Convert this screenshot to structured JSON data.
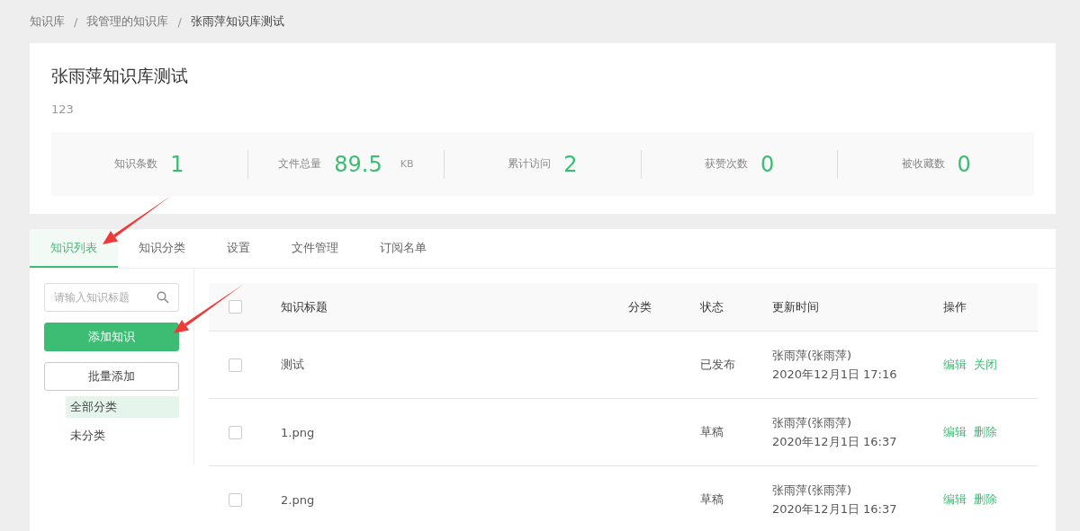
{
  "breadcrumb_separator": "/",
  "breadcrumb": [
    {
      "label": "知识库",
      "current": false
    },
    {
      "label": "我管理的知识库",
      "current": false
    },
    {
      "label": "张雨萍知识库测试",
      "current": true
    }
  ],
  "kb": {
    "title": "张雨萍知识库测试",
    "description": "123"
  },
  "stats": [
    {
      "label": "知识条数",
      "value": "1"
    },
    {
      "label": "文件总量",
      "value": "89.5",
      "unit": "KB"
    },
    {
      "label": "累计访问",
      "value": "2"
    },
    {
      "label": "获赞次数",
      "value": "0"
    },
    {
      "label": "被收藏数",
      "value": "0"
    }
  ],
  "tabs": [
    {
      "label": "知识列表",
      "selected": true
    },
    {
      "label": "知识分类",
      "selected": false
    },
    {
      "label": "设置",
      "selected": false
    },
    {
      "label": "文件管理",
      "selected": false
    },
    {
      "label": "订阅名单",
      "selected": false
    }
  ],
  "sidebar": {
    "search": {
      "placeholder": "请输入知识标题"
    },
    "primary_button": "添加知识",
    "secondary_button": "批量添加",
    "categories": [
      {
        "label": "全部分类",
        "selected": true
      },
      {
        "label": "未分类",
        "selected": false
      }
    ]
  },
  "table": {
    "select_all": {
      "checked": false
    },
    "columns": [
      "知识标题",
      "分类",
      "状态",
      "更新时间",
      "操作"
    ],
    "rows": [
      {
        "checked": false,
        "title": "测试",
        "status": "已发布",
        "author": "张雨萍(张雨萍)",
        "time": "2020年12月1日 17:16",
        "actions": [
          "编辑",
          "关闭"
        ]
      },
      {
        "checked": false,
        "title": "1.png",
        "status": "草稿",
        "author": "张雨萍(张雨萍)",
        "time": "2020年12月1日 16:37",
        "actions": [
          "编辑",
          "删除"
        ]
      },
      {
        "checked": false,
        "title": "2.png",
        "status": "草稿",
        "author": "张雨萍(张雨萍)",
        "time": "2020年12月1日 16:37",
        "actions": [
          "编辑",
          "删除"
        ]
      }
    ]
  }
}
